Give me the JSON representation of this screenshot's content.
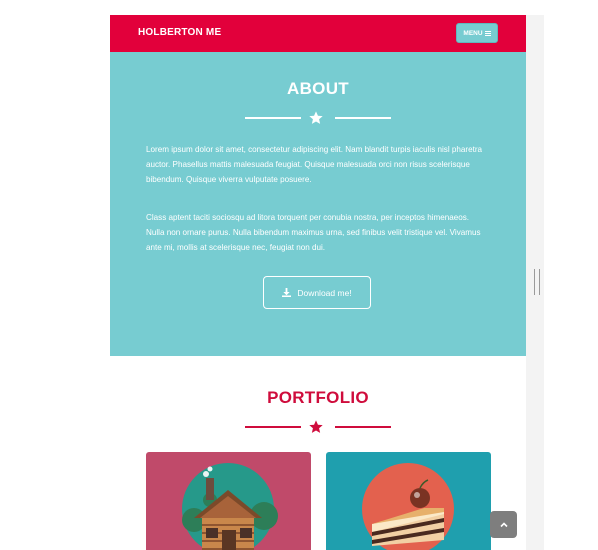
{
  "navbar": {
    "brand": "HOLBERTON ME",
    "menu_label": "MENU",
    "menu_icon": "bars-icon",
    "background": "#e2003b"
  },
  "about": {
    "title": "ABOUT",
    "divider_icon": "star-icon",
    "paragraphs": [
      "Lorem ipsum dolor sit amet, consectetur adipiscing elit. Nam blandit turpis iaculis nisl pharetra auctor. Phasellus mattis malesuada feugiat. Quisque malesuada orci non risus scelerisque bibendum. Quisque viverra vulputate posuere.",
      "Class aptent taciti sociosqu ad litora torquent per conubia nostra, per inceptos himenaeos. Nulla non ornare purus. Nulla bibendum maximus urna, sed finibus velit tristique vel. Vivamus ante mi, mollis at scelerisque nec, feugiat non dui."
    ],
    "download_label": "Download me!",
    "download_icon": "download-icon",
    "background": "#77ccd1"
  },
  "portfolio": {
    "title": "PORTFOLIO",
    "divider_icon": "star-icon",
    "accent": "#cf0c3c",
    "items": [
      {
        "icon": "log-cabin-icon",
        "background": "#c04a6a"
      },
      {
        "icon": "cake-slice-icon",
        "background": "#1f9fae"
      }
    ]
  },
  "scroll_top": {
    "icon": "chevron-up-icon"
  }
}
